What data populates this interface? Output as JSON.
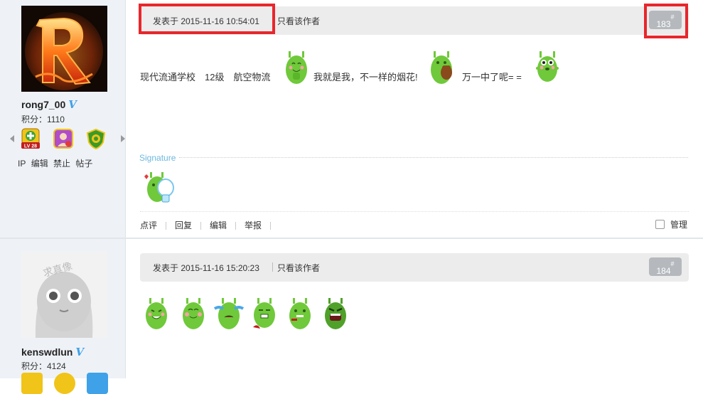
{
  "posts": [
    {
      "username": "rong7_00",
      "score": "积分：1110",
      "medal_level": "LV 28",
      "user_tools": [
        "IP",
        "编辑",
        "禁止",
        "帖子"
      ],
      "posted_at": "发表于 2015-11-16 10:54:01",
      "only_author": "只看该作者",
      "floor_number": "183",
      "floor_mark": "#",
      "text_segments": [
        "现代流通学校　12级　航空物流",
        "我就是我，不一样的烟花!",
        "万一中了呢= ="
      ],
      "signature_label": "Signature",
      "actions": [
        "点评",
        "回复",
        "编辑",
        "举报"
      ],
      "manage_label": "管理"
    },
    {
      "username": "kenswdlun",
      "score": "积分：4124",
      "avatar_text": "求真像",
      "posted_at": "发表于 2015-11-16 15:20:23",
      "only_author": "只看该作者",
      "floor_number": "184",
      "floor_mark": "#"
    }
  ],
  "colors": {
    "highlight": "#e8262b",
    "verified": "#3fa1e8",
    "emoji_green": "#6fc93a",
    "signature": "#6cb8e0"
  },
  "icons": [
    "verified-v-icon",
    "level-medal-icon",
    "user-medal-icon",
    "shield-medal-icon",
    "green-monster-emoji-icon"
  ]
}
